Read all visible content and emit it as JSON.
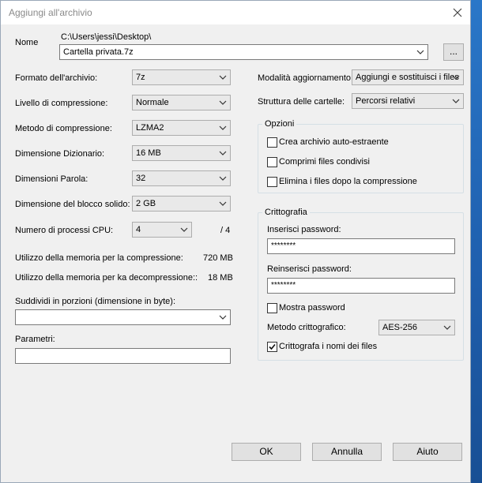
{
  "window": {
    "title": "Aggiungi all'archivio"
  },
  "archive": {
    "name_label": "Nome",
    "path": "C:\\Users\\jessi\\Desktop\\",
    "filename": "Cartella privata.7z",
    "browse_label": "..."
  },
  "left": {
    "format_label": "Formato dell'archivio:",
    "format_value": "7z",
    "level_label": "Livello di compressione:",
    "level_value": "Normale",
    "method_label": "Metodo di compressione:",
    "method_value": "LZMA2",
    "dict_label": "Dimensione Dizionario:",
    "dict_value": "16 MB",
    "word_label": "Dimensioni Parola:",
    "word_value": "32",
    "block_label": "Dimensione del blocco solido:",
    "block_value": "2 GB",
    "cpu_label": "Numero di processi CPU:",
    "cpu_value": "4",
    "cpu_max": "/ 4",
    "mem_comp_label": "Utilizzo della memoria per la compressione:",
    "mem_comp_value": "720 MB",
    "mem_decomp_label": "Utilizzo della memoria per ka decompressione::",
    "mem_decomp_value": "18 MB",
    "split_label": "Suddividi in porzioni (dimensione in byte):",
    "split_value": "",
    "params_label": "Parametri:",
    "params_value": ""
  },
  "right": {
    "update_label": "Modalità aggiornamento:",
    "update_value": "Aggiungi e sostituisci i files",
    "struct_label": "Struttura delle cartelle:",
    "struct_value": "Percorsi relativi"
  },
  "options": {
    "title": "Opzioni",
    "sfx_label": "Crea archivio auto-estraente",
    "sfx_checked": false,
    "shared_label": "Comprimi files condivisi",
    "shared_checked": false,
    "delete_label": "Elimina i files dopo la compressione",
    "delete_checked": false
  },
  "encryption": {
    "title": "Crittografia",
    "pwd_label": "Inserisci password:",
    "pwd_value": "********",
    "pwd2_label": "Reinserisci password:",
    "pwd2_value": "********",
    "show_label": "Mostra password",
    "show_checked": false,
    "method_label": "Metodo crittografico:",
    "method_value": "AES-256",
    "names_label": "Crittografa i nomi dei files",
    "names_checked": true
  },
  "buttons": {
    "ok": "OK",
    "cancel": "Annulla",
    "help": "Aiuto"
  }
}
